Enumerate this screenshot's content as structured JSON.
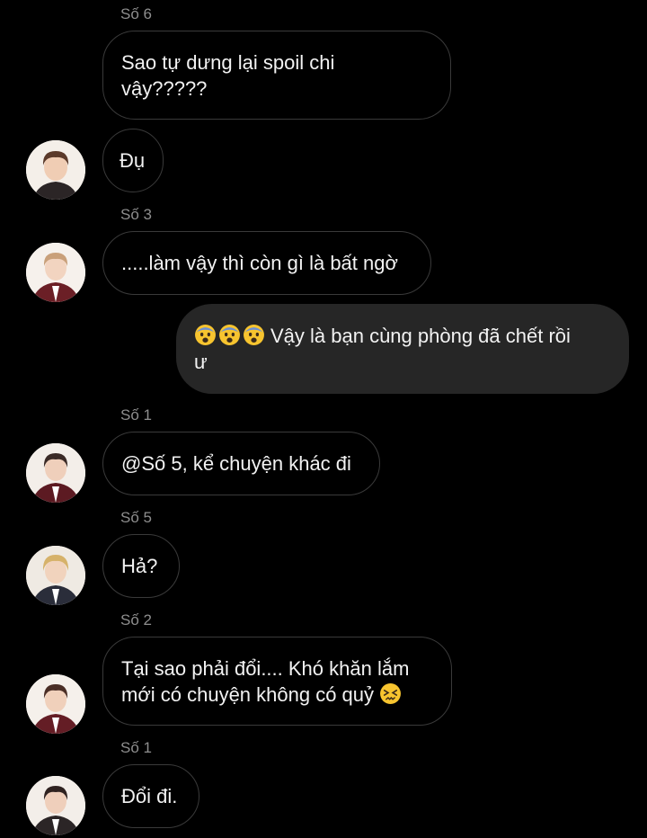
{
  "messages": [
    {
      "sender": "Số 6",
      "text": "Sao tự dưng lại spoil chi\nvậy?????"
    },
    {
      "sender": "",
      "text": "Đụ"
    },
    {
      "sender": "Số 3",
      "text": ".....làm vậy thì còn gì là bất ngờ"
    },
    {
      "sender": "",
      "text": "Vậy là bạn cùng phòng đã chết rồi\nư",
      "emoji": [
        "fearful-face",
        "fearful-face",
        "fearful-face"
      ]
    },
    {
      "sender": "Số 1",
      "text": "@Số 5, kể chuyện khác đi"
    },
    {
      "sender": "Số 5",
      "text": "Hả?"
    },
    {
      "sender": "Số 2",
      "text": "Tại sao phải đổi.... Khó khăn lắm\nmới có chuyện không có quỷ",
      "emoji_end": "confounded-face"
    },
    {
      "sender": "Số 1",
      "text": "Đổi đi."
    }
  ],
  "colors": {
    "background": "#000000",
    "incoming_border": "#3a3a3a",
    "outgoing_bubble": "#262626",
    "sender_name": "#8e8e8e",
    "message_text": "#f2f2f2",
    "emoji_yellow": "#f7c42f"
  }
}
